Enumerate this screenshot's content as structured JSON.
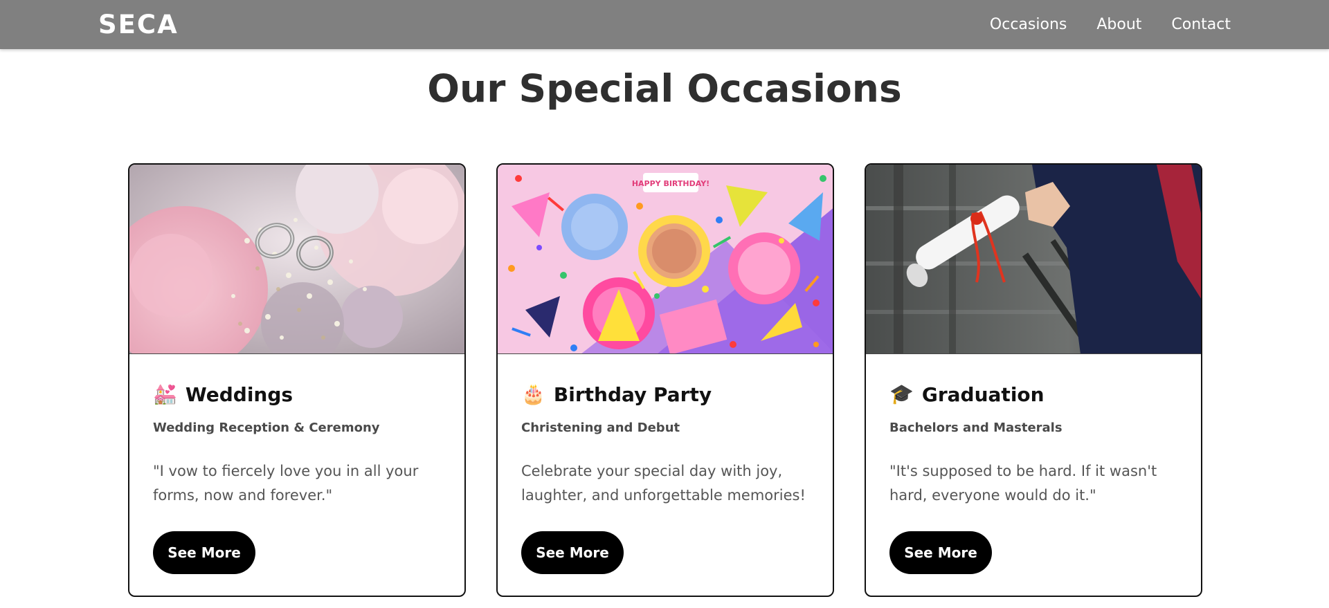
{
  "nav": {
    "brand": "SECA",
    "links": [
      "Occasions",
      "About",
      "Contact"
    ]
  },
  "page": {
    "title": "Our Special Occasions"
  },
  "cards": [
    {
      "emoji": "💒",
      "icon_name": "wedding-chapel-icon",
      "title": "Weddings",
      "subtitle": "Wedding Reception & Ceremony",
      "text": "\"I vow to fiercely love you in all your forms, now and forever.\"",
      "button": "See More",
      "image": "wedding rings resting on pink roses and baby's breath bouquet"
    },
    {
      "emoji": "🎂",
      "icon_name": "birthday-cake-icon",
      "title": "Birthday Party",
      "subtitle": "Christening and Debut",
      "text": "Celebrate your special day with joy, laughter, and unforgettable memories!",
      "button": "See More",
      "image": "colorful party hats, plates, candles, confetti and a sprinkle donut",
      "image_banner": "HAPPY BIRTHDAY!"
    },
    {
      "emoji": "🎓",
      "icon_name": "graduation-cap-icon",
      "title": "Graduation",
      "subtitle": "Bachelors and Masterals",
      "text": "\"It's supposed to be hard. If it wasn't hard, everyone would do it.\"",
      "button": "See More",
      "image": "graduate in navy gown holding a rolled diploma tied with red ribbon"
    }
  ],
  "colors": {
    "navbar": "#808080",
    "button": "#000000",
    "title": "#2f2f2f"
  }
}
